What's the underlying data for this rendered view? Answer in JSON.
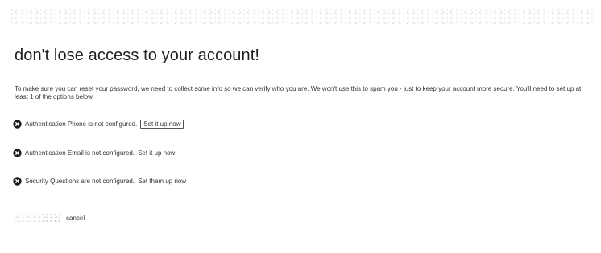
{
  "heading": "don't lose access to your account!",
  "intro": "To make sure you can reset your password, we need to collect some info so we can verify who you are. We won't use this to spam you - just to keep your account more secure. You'll need to set up at least 1 of the options below.",
  "options": [
    {
      "icon": "error-icon",
      "text": "Authentication Phone is not configured.",
      "link": "Set it up now"
    },
    {
      "icon": "error-icon",
      "text": "Authentication Email is not configured.",
      "link": "Set it up now"
    },
    {
      "icon": "error-icon",
      "text": "Security Questions are not configured.",
      "link": "Set them up now"
    }
  ],
  "footer": {
    "cancel": "cancel"
  },
  "colors": {
    "text": "#333333",
    "heading": "#1e1e1e",
    "icon": "#1a1a1a",
    "background": "#ffffff"
  }
}
